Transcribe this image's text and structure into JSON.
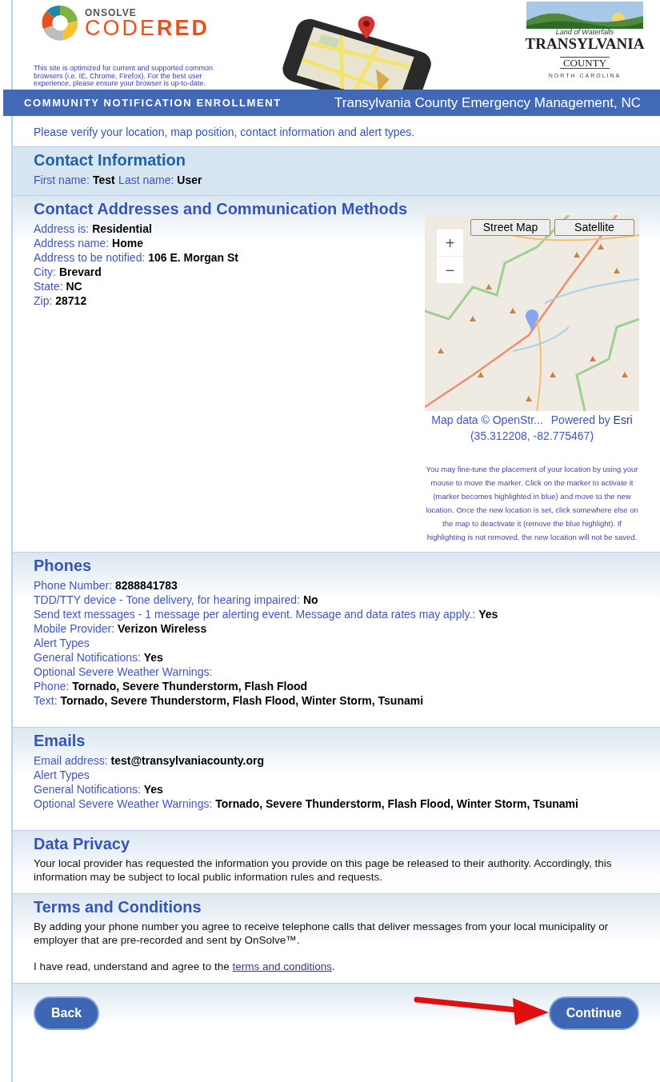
{
  "header": {
    "logo": {
      "brand_top": "ONSOLVE",
      "brand_main": "CODE**RED**"
    },
    "notice": "This site is optimized for current and supported common browsers (i.e. IE, Chrome, Firefox). For the best user experience, please ensure your browser is up-to-date.",
    "county_logo": {
      "tagline": "Land of Waterfalls",
      "name": "TRANSYLVANIA",
      "county": "COUNTY",
      "state": "NORTH CAROLINA"
    }
  },
  "banner": {
    "left": "COMMUNITY NOTIFICATION ENROLLMENT",
    "right": "Transylvania County Emergency Management, NC"
  },
  "intro": "Please verify your location, map position, contact information and alert types.",
  "sections": [
    {
      "kind": "inline",
      "title": "Contact Information",
      "fields": [
        {
          "label": "First name:",
          "value": "Test"
        },
        {
          "label": "Last name:",
          "value": "User"
        }
      ]
    },
    {
      "kind": "address",
      "title": "Contact Addresses and Communication Methods",
      "fields": [
        {
          "label": "Address is:",
          "value": "Residential"
        },
        {
          "label": "Address name:",
          "value": "Home"
        },
        {
          "label": "Address to be notified:",
          "value": "106 E. Morgan St"
        },
        {
          "label": "City:",
          "value": "Brevard"
        },
        {
          "label": "State:",
          "value": "NC"
        },
        {
          "label": "Zip:",
          "value": "28712"
        }
      ],
      "map": {
        "layers": [
          {
            "label": "Street Map"
          },
          {
            "label": "Satellite"
          }
        ],
        "zoom_in": "+",
        "zoom_out": "−",
        "attribution": "Map data © OpenStr...",
        "powered_by": "Powered by",
        "provider": "Esri",
        "coordinates": "(35.312208, -82.775467)",
        "help": "You may fine-tune the placement of your location by using your mouse to move the marker. Click on the marker to activate it (marker becomes highlighted in blue) and move to the new location. Once the new location is set, click somewhere else on the map to deactivate it (remove the blue highlight). If highlighting is not removed, the new location will not be saved."
      }
    },
    {
      "kind": "fields",
      "title": "Phones",
      "fields": [
        {
          "label": "Phone Number:",
          "value": "8288841783"
        },
        {
          "label": "TDD/TTY device - Tone delivery, for hearing impaired:",
          "value": "No"
        },
        {
          "label": "Send text messages - 1 message per alerting event. Message and data rates may apply.:",
          "value": "Yes"
        },
        {
          "label": "Mobile Provider:",
          "value": "Verizon Wireless"
        },
        {
          "label": "Alert Types"
        },
        {
          "label": "General Notifications:",
          "value": "Yes"
        },
        {
          "label": "Optional Severe Weather Warnings:"
        },
        {
          "label": "Phone:",
          "value": "Tornado, Severe Thunderstorm, Flash Flood"
        },
        {
          "label": "Text:",
          "value": "Tornado, Severe Thunderstorm, Flash Flood, Winter Storm, Tsunami"
        }
      ]
    },
    {
      "kind": "fields",
      "title": "Emails",
      "fields": [
        {
          "label": "Email address:",
          "value": "test@transylvaniacounty.org"
        },
        {
          "label": "Alert Types"
        },
        {
          "label": "General Notifications:",
          "value": "Yes"
        },
        {
          "label": "Optional Severe Weather Warnings:",
          "value": "Tornado, Severe Thunderstorm, Flash Flood, Winter Storm, Tsunami"
        }
      ]
    },
    {
      "kind": "text",
      "title": "Data Privacy",
      "paragraphs": [
        {
          "text": "Your local provider has requested the information you provide on this page be released to their authority. Accordingly, this information may be subject to local public information rules and requests."
        }
      ]
    },
    {
      "kind": "text",
      "title": "Terms and Conditions",
      "paragraphs": [
        {
          "text": "By adding your phone number you agree to receive telephone calls that deliver messages from your local municipality or employer that are pre-recorded and sent by OnSolve™."
        },
        {
          "text": "I have read, understand and agree to the ",
          "link": "terms and conditions",
          "after": "."
        }
      ]
    }
  ],
  "footer": {
    "back": "Back",
    "continue": "Continue",
    "arrow_to_continue": true
  }
}
